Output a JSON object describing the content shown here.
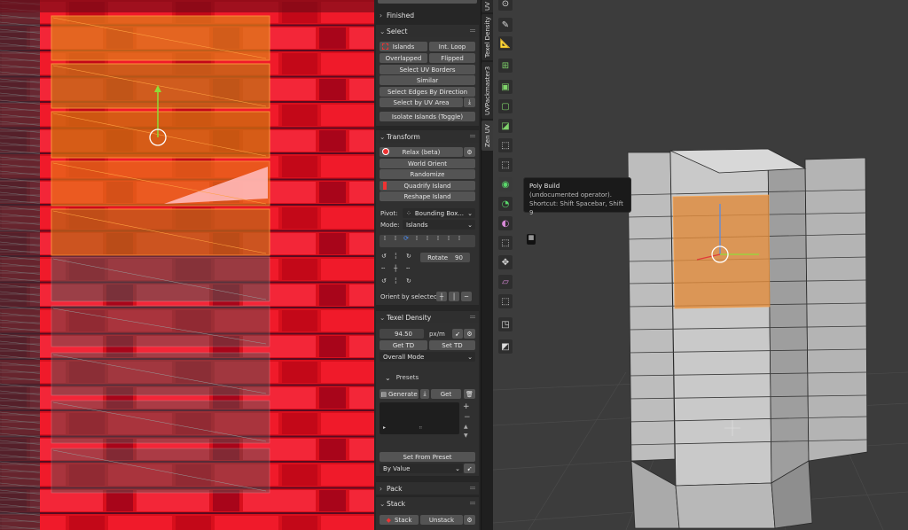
{
  "header": {
    "finished_label": "Finished"
  },
  "select": {
    "title": "Select",
    "islands": "Islands",
    "int_loop": "Int. Loop",
    "overlapped": "Overlapped",
    "flipped": "Flipped",
    "select_uv_borders": "Select UV Borders",
    "similar": "Similar",
    "select_edges_by_direction": "Select Edges By Direction",
    "select_by_uv_area": "Select by UV Area",
    "isolate_islands": "Isolate Islands (Toggle)"
  },
  "transform": {
    "title": "Transform",
    "relax": "Relax (beta)",
    "world_orient": "World Orient",
    "randomize": "Randomize",
    "quadrify": "Quadrify Island",
    "reshape": "Reshape Island",
    "pivot_label": "Pivot:",
    "pivot_value": "Bounding Box...",
    "mode_label": "Mode:",
    "mode_value": "Islands",
    "rotate_label": "Rotate",
    "rotate_value": "90",
    "orient_label": "Orient by selected"
  },
  "texel": {
    "title": "Texel Density",
    "value": "94.50",
    "unit": "px/m",
    "get_td": "Get TD",
    "set_td": "Set TD",
    "overall_mode": "Overall Mode",
    "presets_title": "Presets",
    "generate": "Generate",
    "get": "Get",
    "set_from_preset": "Set From Preset",
    "by_value": "By Value"
  },
  "pack": {
    "title": "Pack"
  },
  "stack": {
    "title": "Stack",
    "stack": "Stack",
    "unstack": "Unstack"
  },
  "tabs": [
    "UV",
    "Texel Density",
    "UVPackmaster3",
    "Zen UV"
  ],
  "tooltip": {
    "title": "Poly Build",
    "desc": "(undocumented operator).",
    "shortcut": "Shortcut: Shift Spacebar, Shift 9"
  },
  "tools": [
    "annotate-icon",
    "measure-icon",
    "add-cube-icon",
    "extrude-icon",
    "inset-icon",
    "bevel-icon",
    "loop-cut-icon",
    "knife-icon",
    "poly-build-icon",
    "spin-icon",
    "smooth-icon",
    "edge-slide-icon",
    "shrink-fatten-icon",
    "shear-icon",
    "to-sphere-icon",
    "rip-icon"
  ],
  "colors": {
    "uv_red": "#e0101c",
    "selection_orange": "#e07a1a",
    "panel_bg": "#262626",
    "viewport_bg": "#3c3c3c"
  }
}
